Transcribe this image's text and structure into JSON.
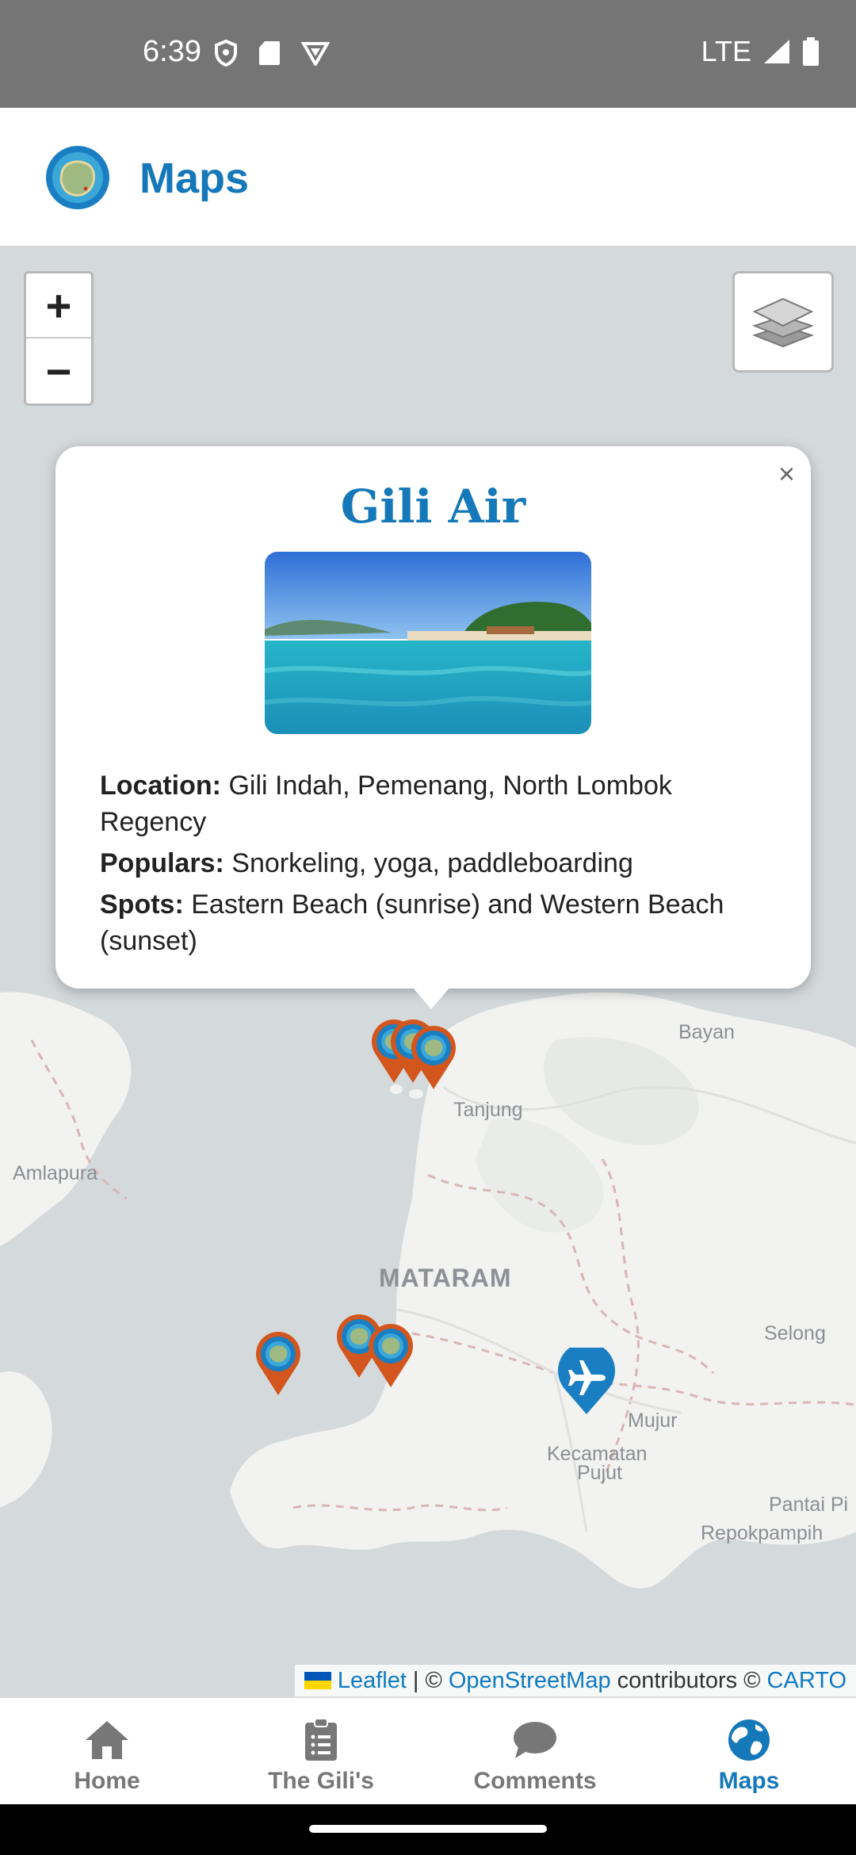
{
  "status_bar": {
    "time": "6:39",
    "network": "LTE",
    "icons": [
      "shield-icon",
      "sd-card-icon",
      "vpn-icon",
      "signal-icon",
      "battery-icon"
    ]
  },
  "app_bar": {
    "title": "Maps",
    "logo_icon": "island-logo-icon"
  },
  "map": {
    "zoom_in": "+",
    "zoom_out": "−",
    "layers_icon": "layers-icon",
    "labels": {
      "bayan": "Bayan",
      "tanjung": "Tanjung",
      "amlapura": "Amlapura",
      "mataram": "MATARAM",
      "selong": "Selong",
      "mujur": "Mujur",
      "kecamatan_pujut_line1": "Kecamatan",
      "kecamatan_pujut_line2": "Pujut",
      "pantai_pi": "Pantai Pi",
      "repokpampih": "Repokpampih"
    },
    "attribution": {
      "leaflet": "Leaflet",
      "separator": "| ©",
      "osm": "OpenStreetMap",
      "contributors": "contributors ©",
      "carto": "CARTO"
    }
  },
  "popup": {
    "close": "×",
    "title": "Gili Air",
    "location_label": "Location:",
    "location_value": "Gili Indah, Pemenang, North Lombok Regency",
    "populars_label": "Populars:",
    "populars_value": "Snorkeling, yoga, paddleboarding",
    "spots_label": "Spots:",
    "spots_value": "Eastern Beach (sunrise) and Western Beach (sunset)"
  },
  "bottom_nav": {
    "items": [
      {
        "label": "Home",
        "icon": "home-icon",
        "active": false
      },
      {
        "label": "The Gili's",
        "icon": "clipboard-list-icon",
        "active": false
      },
      {
        "label": "Comments",
        "icon": "comment-icon",
        "active": false
      },
      {
        "label": "Maps",
        "icon": "globe-icon",
        "active": true
      }
    ]
  },
  "colors": {
    "brand_blue": "#1578b9",
    "marker_orange": "#d2561d",
    "map_water": "#d4d9dc",
    "map_land": "#f2f2f0"
  }
}
